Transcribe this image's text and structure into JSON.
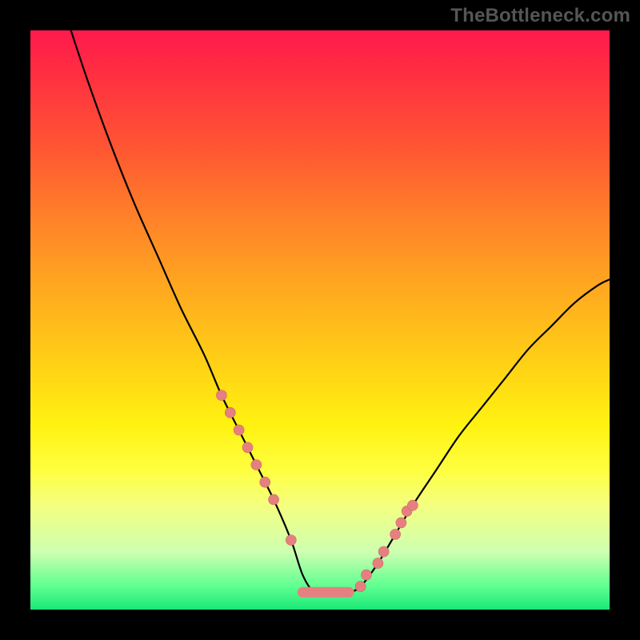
{
  "watermark": "TheBottleneck.com",
  "colors": {
    "curve": "#000000",
    "marker_fill": "#e68080",
    "marker_stroke": "#cc6666",
    "flat_segment": "#e68080"
  },
  "chart_data": {
    "type": "line",
    "title": "",
    "xlabel": "",
    "ylabel": "",
    "xlim": [
      0,
      100
    ],
    "ylim": [
      0,
      100
    ],
    "description": "Bottleneck percentage curve. Y axis represents bottleneck severity (top=100%, bottom=0%). Background gradient encodes severity: red high near top, green optimal near bottom. Curve dips to a flat optimal zone near x≈47-56 at y≈3.",
    "series": [
      {
        "name": "bottleneck_curve",
        "x": [
          7,
          10,
          14,
          18,
          22,
          26,
          30,
          33,
          36,
          39,
          42,
          45,
          47,
          49,
          51,
          53,
          55,
          57,
          60,
          63,
          66,
          70,
          74,
          78,
          82,
          86,
          90,
          94,
          98,
          100
        ],
        "y": [
          100,
          91,
          80,
          70,
          61,
          52,
          44,
          37,
          31,
          25,
          19,
          12,
          6,
          3,
          3,
          3,
          3,
          4,
          8,
          13,
          18,
          24,
          30,
          35,
          40,
          45,
          49,
          53,
          56,
          57
        ]
      }
    ],
    "markers": {
      "left": [
        [
          33,
          37
        ],
        [
          34.5,
          34
        ],
        [
          36,
          31
        ],
        [
          37.5,
          28
        ],
        [
          39,
          25
        ],
        [
          40.5,
          22
        ],
        [
          42,
          19
        ],
        [
          45,
          12
        ]
      ],
      "right": [
        [
          57,
          4
        ],
        [
          58,
          6
        ],
        [
          60,
          8
        ],
        [
          61,
          10
        ],
        [
          63,
          13
        ],
        [
          64,
          15
        ],
        [
          65,
          17
        ],
        [
          66,
          18
        ]
      ],
      "flat_segment": {
        "x0": 47,
        "x1": 55,
        "y": 3
      }
    }
  }
}
